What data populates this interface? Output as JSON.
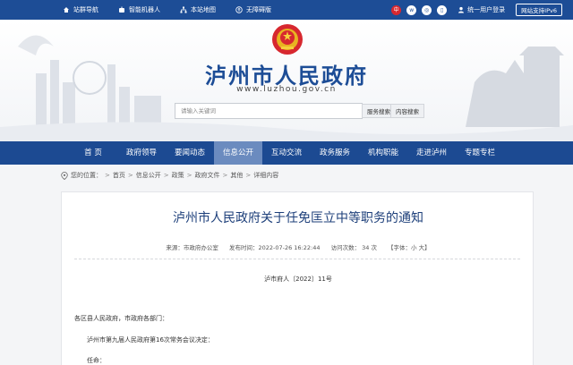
{
  "topbar": {
    "links": [
      {
        "icon": "home-icon",
        "label": "站群导航"
      },
      {
        "icon": "robot-icon",
        "label": "智能机器人"
      },
      {
        "icon": "sitemap-icon",
        "label": "本站地图"
      },
      {
        "icon": "accessibility-icon",
        "label": "无障碍版"
      }
    ],
    "lang_zh": "中",
    "login_label": "统一用户登录",
    "ipv6_label": "网站支持IPv6"
  },
  "header": {
    "site_title": "泸州市人民政府",
    "site_url": "www.luzhou.gov.cn"
  },
  "search": {
    "placeholder": "请输入关键词",
    "service_search": "服务搜索",
    "content_search": "内容搜索"
  },
  "nav": {
    "items": [
      "首 页",
      "政府领导",
      "要闻动态",
      "信息公开",
      "互动交流",
      "政务服务",
      "机构职能",
      "走进泸州",
      "专题专栏"
    ],
    "active": "信息公开"
  },
  "breadcrumb": {
    "prefix": "您的位置：",
    "items": [
      "首页",
      "信息公开",
      "政策",
      "政府文件",
      "其他",
      "详细内容"
    ]
  },
  "article": {
    "title": "泸州市人民政府关于任免匡立中等职务的通知",
    "source": "来源：市政府办公室",
    "published": "发布时间：2022-07-26 16:22:44",
    "views": "访问次数： 34 次",
    "font_size": "【字体：小 大】",
    "doc_number": "泸市府人〔2022〕11号",
    "greeting": "各区县人民政府，市政府各部门：",
    "para1": "泸州市第九届人民政府第16次常务会议决定：",
    "para2": "任命："
  },
  "colors": {
    "primary_blue": "#1d4d96",
    "nav_active": "#6b8bbf"
  }
}
